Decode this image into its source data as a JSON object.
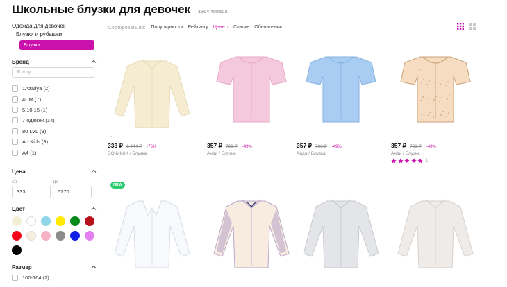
{
  "header": {
    "title": "Школьные блузки для девочек",
    "count": "3364 товара"
  },
  "sidebar": {
    "category_title": "Одежда для девочек",
    "category_sub": "Блузки и рубашки",
    "category_active": "Блузки",
    "brand": {
      "title": "Бренд",
      "search_placeholder": "Я ищу...",
      "items": [
        {
          "label": "1Azaliya (2)"
        },
        {
          "label": "4DM (7)"
        },
        {
          "label": "5.10.15 (1)"
        },
        {
          "label": "7 одежек (14)"
        },
        {
          "label": "80 LVL (9)"
        },
        {
          "label": "A.I.Kids (3)"
        },
        {
          "label": "A4 (1)"
        }
      ]
    },
    "price": {
      "title": "Цена",
      "from_label": "От",
      "to_label": "До",
      "from_value": "333",
      "to_value": "5770"
    },
    "color": {
      "title": "Цвет",
      "swatches": [
        {
          "name": "beige",
          "hex": "#f3efd6"
        },
        {
          "name": "white",
          "hex": "#ffffff"
        },
        {
          "name": "light-blue",
          "hex": "#8fd6ea"
        },
        {
          "name": "yellow",
          "hex": "#ffea00"
        },
        {
          "name": "green",
          "hex": "#0a8a1a"
        },
        {
          "name": "dark-red",
          "hex": "#b5121b"
        },
        {
          "name": "red",
          "hex": "#f2061a"
        },
        {
          "name": "light-beige",
          "hex": "#f7eedd"
        },
        {
          "name": "pink",
          "hex": "#f7b3c6"
        },
        {
          "name": "gray",
          "hex": "#8c8c8c"
        },
        {
          "name": "blue",
          "hex": "#0f1fe6"
        },
        {
          "name": "purple",
          "hex": "#e47ff2"
        },
        {
          "name": "black",
          "hex": "#000000"
        }
      ]
    },
    "size": {
      "title": "Размер",
      "items": [
        {
          "label": "100-164 (2)"
        }
      ]
    }
  },
  "sort": {
    "label": "Сортировать по:",
    "options": [
      "Популярности",
      "Рейтингу",
      "Цене ↑",
      "Скидке",
      "Обновлению"
    ],
    "active_index": 2
  },
  "products": [
    {
      "price": "333 ₽",
      "old_price": "1 444 ₽",
      "discount": "-76%",
      "meta": "DO-MINIK / Блузка",
      "blouse_color": "#f6ecd2",
      "blouse_accent": "#e6d9b6",
      "mark": "••"
    },
    {
      "price": "357 ₽",
      "old_price": "700 ₽",
      "discount": "-49%",
      "meta": "Анди / Блузка",
      "blouse_color": "#f5c9dd",
      "blouse_accent": "#e6a9c5"
    },
    {
      "price": "357 ₽",
      "old_price": "700 ₽",
      "discount": "-49%",
      "meta": "Анди / Блузка",
      "blouse_color": "#a9cdf2",
      "blouse_accent": "#87b2e2"
    },
    {
      "price": "357 ₽",
      "old_price": "700 ₽",
      "discount": "-49%",
      "meta": "Анди / Блузка",
      "blouse_color": "#f6dcc0",
      "blouse_accent": "#caa27a",
      "rating_value": 5,
      "rating_count": "1"
    },
    {
      "badge": "NEW",
      "blouse_color": "#f7f9fc",
      "blouse_accent": "#d5dce6"
    },
    {
      "blouse_color": "#f7ecdf",
      "blouse_accent": "#b9a7c9"
    },
    {
      "blouse_color": "#e4e5e8",
      "blouse_accent": "#c8cacf"
    },
    {
      "blouse_color": "#eeebe9",
      "blouse_accent": "#d6d1cd"
    }
  ],
  "colors": {
    "accent": "#cb11ab",
    "new_badge": "#2ecc71"
  }
}
